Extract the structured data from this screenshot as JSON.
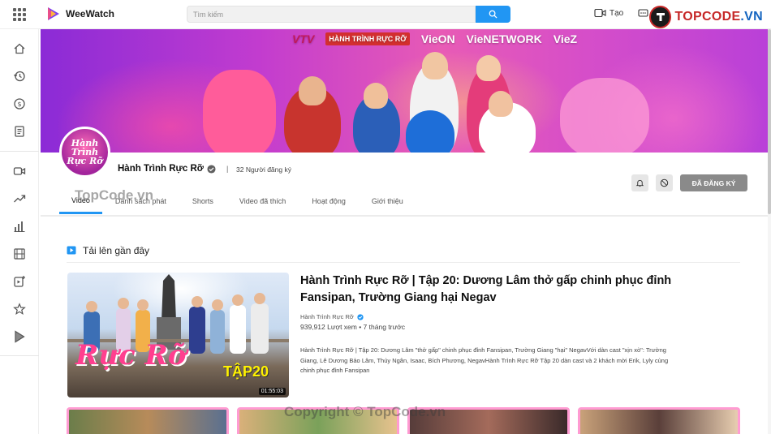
{
  "app": {
    "name": "WeeWatch"
  },
  "header": {
    "search_placeholder": "Tìm kiếm",
    "create_label": "Tạo",
    "brand_text_main": "TOPCODE",
    "brand_text_suffix": ".VN"
  },
  "banner": {
    "logos": [
      "VTV",
      "HÀNH TRÌNH RỰC RỠ",
      "VieON",
      "VieNETWORK",
      "VieZ"
    ]
  },
  "channel": {
    "name": "Hành Trình Rực Rỡ",
    "separator": "|",
    "subscribers": "32 Người đăng ký",
    "subscribe_label": "ĐÃ ĐĂNG KÝ",
    "avatar_text": "Hành Trình Rực Rỡ"
  },
  "tabs": [
    {
      "label": "Video",
      "active": true
    },
    {
      "label": "Danh sách phát",
      "active": false
    },
    {
      "label": "Shorts",
      "active": false
    },
    {
      "label": "Video đã thích",
      "active": false
    },
    {
      "label": "Hoạt động",
      "active": false
    },
    {
      "label": "Giới thiệu",
      "active": false
    }
  ],
  "section": {
    "title": "Tải lên gần đây"
  },
  "featured": {
    "title": "Hành Trình Rực Rỡ | Tập 20: Dương Lâm thở gấp chinh phục đỉnh Fansipan, Trường Giang hại Negav",
    "channel": "Hành Trình Rực Rỡ",
    "meta": "939,912 Lượt xem • 7 tháng trước",
    "description": "Hành Trình Rực Rỡ | Tập 20: Dương Lâm \"thở gấp\" chinh phục đỉnh Fansipan, Trường Giang \"hại\" NegavVới dàn cast \"xịn xò\": Trường Giang, Lê Dương Bảo Lâm, Thúy Ngân, Isaac, Bích Phương, NegavHành Trình Rực Rỡ Tập 20 dàn cast và 2 khách mời Erik, Lyly cùng chinh phục đỉnh Fansipan",
    "duration": "01:55:03",
    "thumb_art_title": "Rực Rỡ",
    "thumb_art_episode": "TẬP20"
  },
  "watermarks": {
    "top": "TopCode.vn",
    "bottom": "Copyright © TopCode.vn"
  },
  "colors": {
    "accent": "#2196f3",
    "subscribe_bg": "#8a8a8a",
    "banner_pink": "#e85bb5"
  }
}
